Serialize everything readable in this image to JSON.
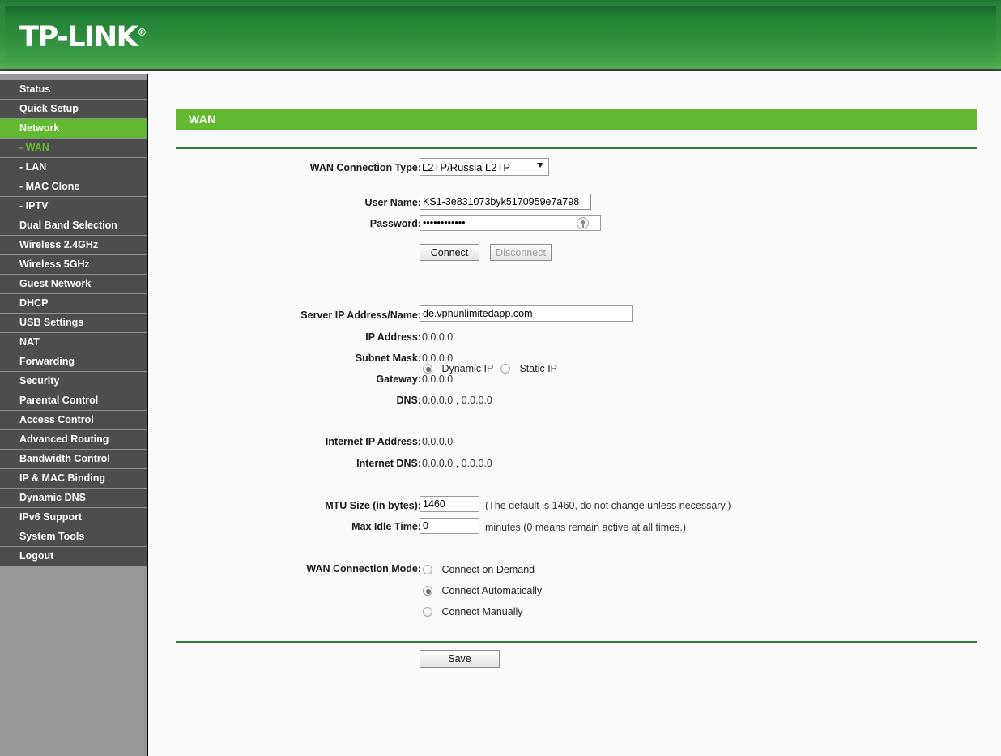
{
  "header": {
    "brand": "TP-LINK",
    "brand_mark": "®"
  },
  "sidebar": {
    "items": [
      {
        "label": "Status",
        "type": "top",
        "state": "normal"
      },
      {
        "label": "Quick Setup",
        "type": "top",
        "state": "normal"
      },
      {
        "label": "Network",
        "type": "top",
        "state": "active"
      },
      {
        "label": "- WAN",
        "type": "sub",
        "state": "selected"
      },
      {
        "label": "- LAN",
        "type": "sub",
        "state": "normal"
      },
      {
        "label": "- MAC Clone",
        "type": "sub",
        "state": "normal"
      },
      {
        "label": "- IPTV",
        "type": "sub",
        "state": "normal"
      },
      {
        "label": "Dual Band Selection",
        "type": "top",
        "state": "normal"
      },
      {
        "label": "Wireless 2.4GHz",
        "type": "top",
        "state": "normal"
      },
      {
        "label": "Wireless 5GHz",
        "type": "top",
        "state": "normal"
      },
      {
        "label": "Guest Network",
        "type": "top",
        "state": "normal"
      },
      {
        "label": "DHCP",
        "type": "top",
        "state": "normal"
      },
      {
        "label": "USB Settings",
        "type": "top",
        "state": "normal"
      },
      {
        "label": "NAT",
        "type": "top",
        "state": "normal"
      },
      {
        "label": "Forwarding",
        "type": "top",
        "state": "normal"
      },
      {
        "label": "Security",
        "type": "top",
        "state": "normal"
      },
      {
        "label": "Parental Control",
        "type": "top",
        "state": "normal"
      },
      {
        "label": "Access Control",
        "type": "top",
        "state": "normal"
      },
      {
        "label": "Advanced Routing",
        "type": "top",
        "state": "normal"
      },
      {
        "label": "Bandwidth Control",
        "type": "top",
        "state": "normal"
      },
      {
        "label": "IP & MAC Binding",
        "type": "top",
        "state": "normal"
      },
      {
        "label": "Dynamic DNS",
        "type": "top",
        "state": "normal"
      },
      {
        "label": "IPv6 Support",
        "type": "top",
        "state": "normal"
      },
      {
        "label": "System Tools",
        "type": "top",
        "state": "normal"
      },
      {
        "label": "Logout",
        "type": "top",
        "state": "normal"
      }
    ]
  },
  "page": {
    "title": "WAN"
  },
  "form": {
    "wan_type": {
      "label": "WAN Connection Type:",
      "value": "L2TP/Russia L2TP",
      "options": [
        "L2TP/Russia L2TP"
      ]
    },
    "user_name": {
      "label": "User Name:",
      "value": "KS1-3e831073byk5170959e7a798"
    },
    "password": {
      "label": "Password:",
      "value": "••••••••••••"
    },
    "connect_button": {
      "label": "Connect",
      "disabled": false
    },
    "disconnect_button": {
      "label": "Disconnect",
      "disabled": true
    },
    "ip_mode": {
      "options": [
        {
          "label": "Dynamic IP",
          "selected": true
        },
        {
          "label": "Static IP",
          "selected": false
        }
      ]
    },
    "server_ip": {
      "label": "Server IP Address/Name:",
      "value": "de.vpnunlimitedapp.com"
    },
    "ip_address": {
      "label": "IP Address:",
      "value": "0.0.0.0"
    },
    "subnet_mask": {
      "label": "Subnet Mask:",
      "value": "0.0.0.0"
    },
    "gateway": {
      "label": "Gateway:",
      "value": "0.0.0.0"
    },
    "dns": {
      "label": "DNS:",
      "value": "0.0.0.0 , 0.0.0.0"
    },
    "internet_ip": {
      "label": "Internet IP Address:",
      "value": "0.0.0.0"
    },
    "internet_dns": {
      "label": "Internet DNS:",
      "value": "0.0.0.0 , 0.0.0.0"
    },
    "mtu": {
      "label": "MTU Size (in bytes):",
      "value": "1460",
      "hint": "(The default is 1460, do not change unless necessary.)"
    },
    "max_idle": {
      "label": "Max Idle Time:",
      "value": "0",
      "hint": "minutes (0 means remain active at all times.)"
    },
    "connection_mode": {
      "label": "WAN Connection Mode:",
      "options": [
        {
          "label": "Connect on Demand",
          "selected": false
        },
        {
          "label": "Connect Automatically",
          "selected": true
        },
        {
          "label": "Connect Manually",
          "selected": false
        }
      ]
    },
    "save_button": {
      "label": "Save"
    }
  },
  "colors": {
    "brand_green": "#62b92f",
    "header_green": "#2c8c3b",
    "sidebar_item": "#4d4d4d",
    "sidebar_bg": "#979797",
    "rule_green": "#2e7d32"
  }
}
